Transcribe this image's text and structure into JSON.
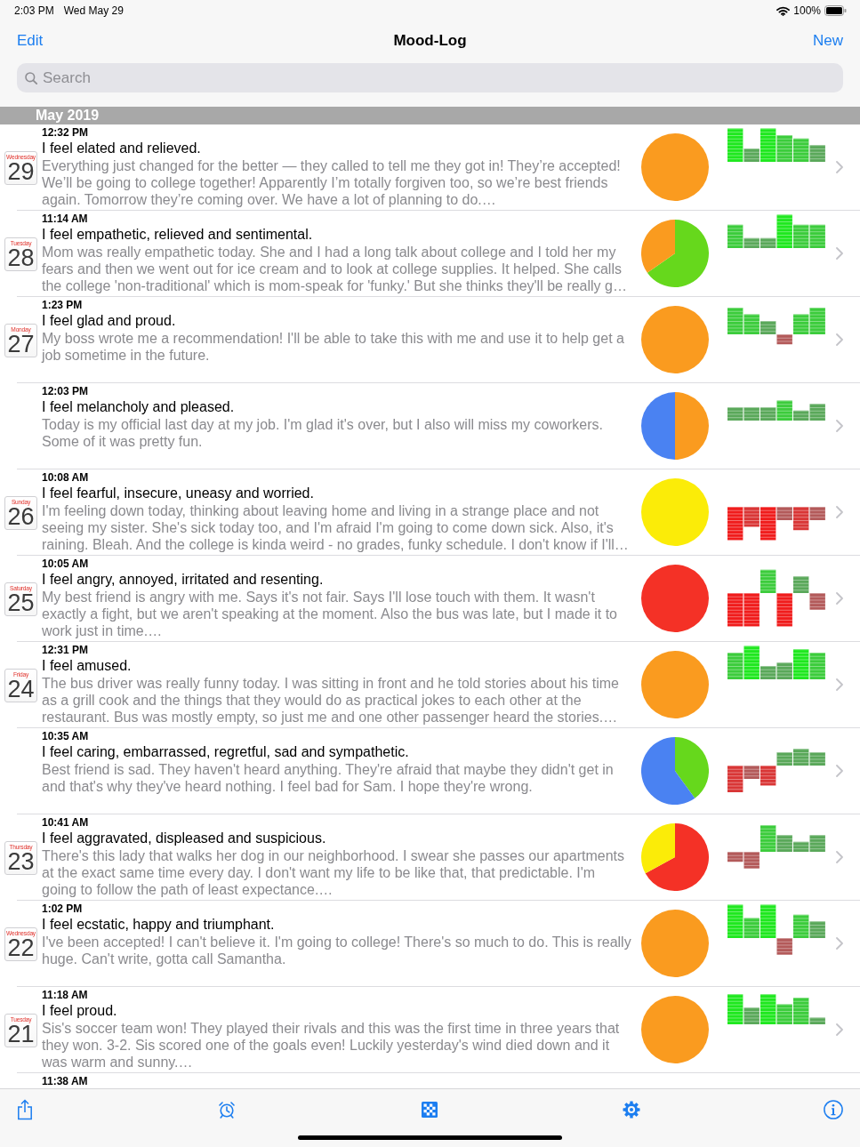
{
  "status_bar": {
    "time": "2:03 PM",
    "date": "Wed May 29",
    "battery": "100%"
  },
  "nav_bar": {
    "edit": "Edit",
    "title": "Mood-Log",
    "new": "New"
  },
  "search": {
    "placeholder": "Search"
  },
  "sections": [
    {
      "title": "May 2019",
      "entries": [
        {
          "day": {
            "weekday": "Wednesday",
            "number": "29"
          },
          "time": "12:32 PM",
          "title": "I feel elated and relieved.",
          "text": "Everything just changed for the better — they called to tell me they got in! They’re accepted! We’ll be going to college together! Apparently I’m totally forgiven too, so we’re best friends again. Tomorrow they’re coming over. We have a lot of planning to do.…"
        },
        {
          "day": {
            "weekday": "Tuesday",
            "number": "28"
          },
          "time": "11:14 AM",
          "title": "I feel empathetic, relieved and sentimental.",
          "text": "Mom was really empathetic today. She and I had a long talk about college and I told her my fears and then we went out for ice cream and to look at college supplies. It helped. She calls the college 'non-traditional' which is mom-speak for 'funky.' But she thinks they'll be really g…"
        },
        {
          "day": {
            "weekday": "Monday",
            "number": "27"
          },
          "time": "1:23 PM",
          "title": "I feel glad and proud.",
          "text": "My boss wrote me a recommendation! I'll be able to take this with me and use it to help get a job sometime in the future."
        },
        {
          "time": "12:03 PM",
          "title": "I feel melancholy and pleased.",
          "text": "Today is my official last day at my job. I'm glad it's over, but I also will miss my coworkers. Some of it was pretty fun."
        },
        {
          "day": {
            "weekday": "Sunday",
            "number": "26"
          },
          "time": "10:08 AM",
          "title": "I feel fearful, insecure, uneasy and worried.",
          "text": "I'm feeling down today, thinking about leaving home and living in a strange place and not seeing my sister. She's sick today too, and I'm afraid I'm going to come down sick. Also, it's raining. Bleah. And the college is kinda weird - no grades, funky schedule. I don't know if I'll…"
        },
        {
          "day": {
            "weekday": "Saturday",
            "number": "25"
          },
          "time": "10:05 AM",
          "title": "I feel angry, annoyed, irritated and resenting.",
          "text": "My best friend is angry with me. Says it's not fair. Says I'll lose touch with them. It wasn't exactly a fight, but we aren't speaking at the moment. Also the bus was late, but I made it to work just in time.…"
        },
        {
          "day": {
            "weekday": "Friday",
            "number": "24"
          },
          "time": "12:31 PM",
          "title": "I feel amused.",
          "text": "The bus driver was really funny today. I was sitting in front and he told stories about his time as a grill cook and the things that they would do as practical jokes to each other at the restaurant. Bus was mostly empty, so just me and one other passenger heard the stories.…"
        },
        {
          "time": "10:35 AM",
          "title": "I feel caring, embarrassed, regretful, sad and sympathetic.",
          "text": "Best friend is sad. They haven't heard anything. They're afraid that maybe they didn't get in and that's why they've heard nothing. I feel bad for Sam. I hope they're wrong."
        },
        {
          "day": {
            "weekday": "Thursday",
            "number": "23"
          },
          "time": "10:41 AM",
          "title": "I feel aggravated, displeased and suspicious.",
          "text": "There's this lady that walks her dog in our neighborhood. I swear she passes our apartments at the exact same time every day. I don't want my life to be like that, that predictable. I'm going to follow the path of least expectance.…"
        },
        {
          "day": {
            "weekday": "Wednesday",
            "number": "22"
          },
          "time": "1:02 PM",
          "title": "I feel ecstatic, happy and triumphant.",
          "text": "I've been accepted! I can't believe it. I'm going to college! There's so much to do. This is really huge. Can't write, gotta call Samantha."
        },
        {
          "day": {
            "weekday": "Tuesday",
            "number": "21"
          },
          "time": "11:18 AM",
          "title": "I feel proud.",
          "text": "Sis's soccer team won! They played their rivals and this was the first time in three years that they won. 3-2. Sis scored one of the goals even! Luckily yesterday's wind died down and it was warm and sunny.…"
        },
        {
          "time": "11:38 AM"
        }
      ]
    }
  ]
}
